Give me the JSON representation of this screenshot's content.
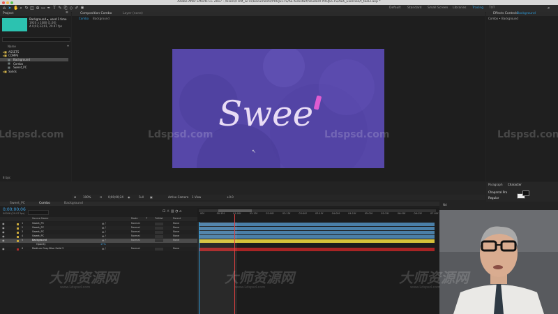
{
  "app": {
    "title": "Adobe After Effects CC 2017 - /Users/TOM_Gr7s/Documents/PROJECTS/AE Kickstart/Student PROJECTS/AEK_Exercise/t_tool2.aep *"
  },
  "workspaces": [
    {
      "label": "Default",
      "active": false
    },
    {
      "label": "Standard",
      "active": false
    },
    {
      "label": "Small Screen",
      "active": false
    },
    {
      "label": "Libraries",
      "active": false
    },
    {
      "label": "Tracing",
      "active": true
    },
    {
      "label": "TXT",
      "active": false
    }
  ],
  "project": {
    "header": "Project",
    "item_name": "Background ▾, used 1 time",
    "item_size": "1920 x 1080 (1.00)",
    "item_duration": "Δ 0;01;33;01, 29.97 fps",
    "search_placeholder": "",
    "column_name": "Name",
    "tree": [
      {
        "label": "ASSETS",
        "indent": 0,
        "type": "folder",
        "selected": false
      },
      {
        "label": "COMPS",
        "indent": 0,
        "type": "folder",
        "selected": false
      },
      {
        "label": "Background",
        "indent": 1,
        "type": "comp",
        "selected": true
      },
      {
        "label": "Combo",
        "indent": 1,
        "type": "comp",
        "selected": false
      },
      {
        "label": "Sweet_PC",
        "indent": 1,
        "type": "comp",
        "selected": false
      },
      {
        "label": "Solids",
        "indent": 0,
        "type": "folder",
        "selected": false
      }
    ],
    "footer": "8 bpc"
  },
  "composition": {
    "tab_label": "Composition Combo",
    "layer_tab": "Layer (none)",
    "breadcrumb": [
      "Combo",
      "Background"
    ],
    "artwork_text": "Swee",
    "footer": {
      "zoom": "100%",
      "timecode": "0;00;00;24",
      "resolution": "Full",
      "camera": "Active Camera",
      "views": "1 View",
      "exposure": "+0.0"
    }
  },
  "effects": {
    "header": "Effects Controls",
    "layer": "Background",
    "breadcrumb": "Combo • Background"
  },
  "character": {
    "tabs": [
      "Paragraph",
      "Character"
    ],
    "font": "Chaparral Pro",
    "style": "Regular"
  },
  "timeline": {
    "tabs": [
      "Sweet_PC",
      "Combo",
      "Background"
    ],
    "timecode": "0;00;00;06",
    "timecode_sub": "00006 (29.97 fps)",
    "columns": [
      "Source Name",
      "Mode",
      "T",
      "TrkMat",
      "Parent"
    ],
    "ruler": [
      "00f",
      "00:15f",
      "01:00f",
      "01:15f",
      "02:00f",
      "02:15f",
      "03:00f",
      "03:15f",
      "04:00f",
      "04:15f",
      "05:00f",
      "05:15f",
      "06:00f",
      "06:15f",
      "07:00f"
    ],
    "layers": [
      {
        "num": "1",
        "name": "Sweet_PC",
        "mode": "Normal",
        "parent": "None",
        "label_color": "#c8a83c",
        "bar_color": "#4a7fa8",
        "selected": false
      },
      {
        "num": "2",
        "name": "Sweet_PC",
        "mode": "Normal",
        "parent": "None",
        "label_color": "#c8a83c",
        "bar_color": "#4a7fa8",
        "selected": false
      },
      {
        "num": "3",
        "name": "Sweet_PC",
        "mode": "Normal",
        "parent": "None",
        "label_color": "#c8a83c",
        "bar_color": "#4a7fa8",
        "selected": false
      },
      {
        "num": "4",
        "name": "Sweet_PC",
        "mode": "Normal",
        "parent": "None",
        "label_color": "#c8a83c",
        "bar_color": "#4a7fa8",
        "selected": false
      },
      {
        "num": "5",
        "name": "Background",
        "mode": "Normal",
        "parent": "None",
        "label_color": "#c8a83c",
        "bar_color": "#d6c23a",
        "selected": true
      },
      {
        "num": "",
        "name": "Opacity",
        "mode": "",
        "parent": "",
        "label_color": "",
        "bar_color": "",
        "selected": false,
        "prop_value": "17%"
      },
      {
        "num": "6",
        "name": "Medium Gray-Blue Solid 3",
        "mode": "Normal",
        "parent": "None",
        "label_color": "#b02a2a",
        "bar_color": "#a82424",
        "selected": false
      }
    ]
  },
  "watermarks": {
    "latin": "Ldspsd.com",
    "cn": "大师资源网",
    "cn_sub": "www.Ldspsd.com"
  },
  "colors": {
    "comp_bg": "#5647a8",
    "accent": "#2d9cdb",
    "pink": "#e05cd0"
  },
  "webcam": {
    "label": "presenter video"
  }
}
